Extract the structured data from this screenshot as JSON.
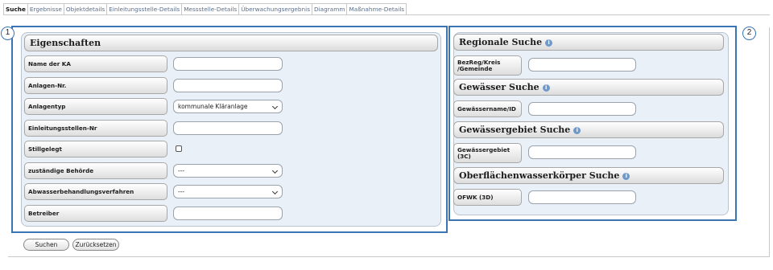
{
  "tabs": [
    {
      "label": "Suche",
      "active": true
    },
    {
      "label": "Ergebnisse"
    },
    {
      "label": "Objektdetails"
    },
    {
      "label": "Einleitungsstelle-Details"
    },
    {
      "label": "Messstelle-Details"
    },
    {
      "label": "Überwachungsergebnis"
    },
    {
      "label": "Diagramm"
    },
    {
      "label": "Maßnahme-Details"
    }
  ],
  "markers": {
    "m1": "1",
    "m2": "2"
  },
  "left": {
    "title": "Eigenschaften",
    "rows": [
      {
        "label": "Name der KA",
        "type": "text",
        "value": ""
      },
      {
        "label": "Anlagen-Nr.",
        "type": "text",
        "value": ""
      },
      {
        "label": "Anlagentyp",
        "type": "select",
        "value": "kommunale Kläranlage"
      },
      {
        "label": "Einleitungsstellen-Nr",
        "type": "text",
        "value": ""
      },
      {
        "label": "Stillgelegt",
        "type": "checkbox",
        "checked": false
      },
      {
        "label": "zuständige Behörde",
        "type": "select",
        "value": "---"
      },
      {
        "label": "Abwasserbehandlungsverfahren",
        "type": "select",
        "value": "---"
      },
      {
        "label": "Betreiber",
        "type": "text",
        "value": ""
      }
    ]
  },
  "right": {
    "sections": [
      {
        "title": "Regionale Suche",
        "field_label_1": "BezReg/Kreis",
        "field_label_2": "/Gemeinde"
      },
      {
        "title": "Gewässer Suche",
        "field_label_1": "Gewässername/ID",
        "field_label_2": ""
      },
      {
        "title": "Gewässergebiet Suche",
        "field_label_1": "Gewässergebiet",
        "field_label_2": "(3C)"
      },
      {
        "title": "Oberflächenwasserkörper Suche",
        "field_label_1": "OFWK (3D)",
        "field_label_2": ""
      }
    ],
    "info_glyph": "i"
  },
  "buttons": {
    "search": "Suchen",
    "reset": "Zurücksetzen"
  },
  "colors": {
    "highlight": "#3a74b2",
    "panel_bg": "#e9f0f7",
    "info": "#6f99c8"
  }
}
